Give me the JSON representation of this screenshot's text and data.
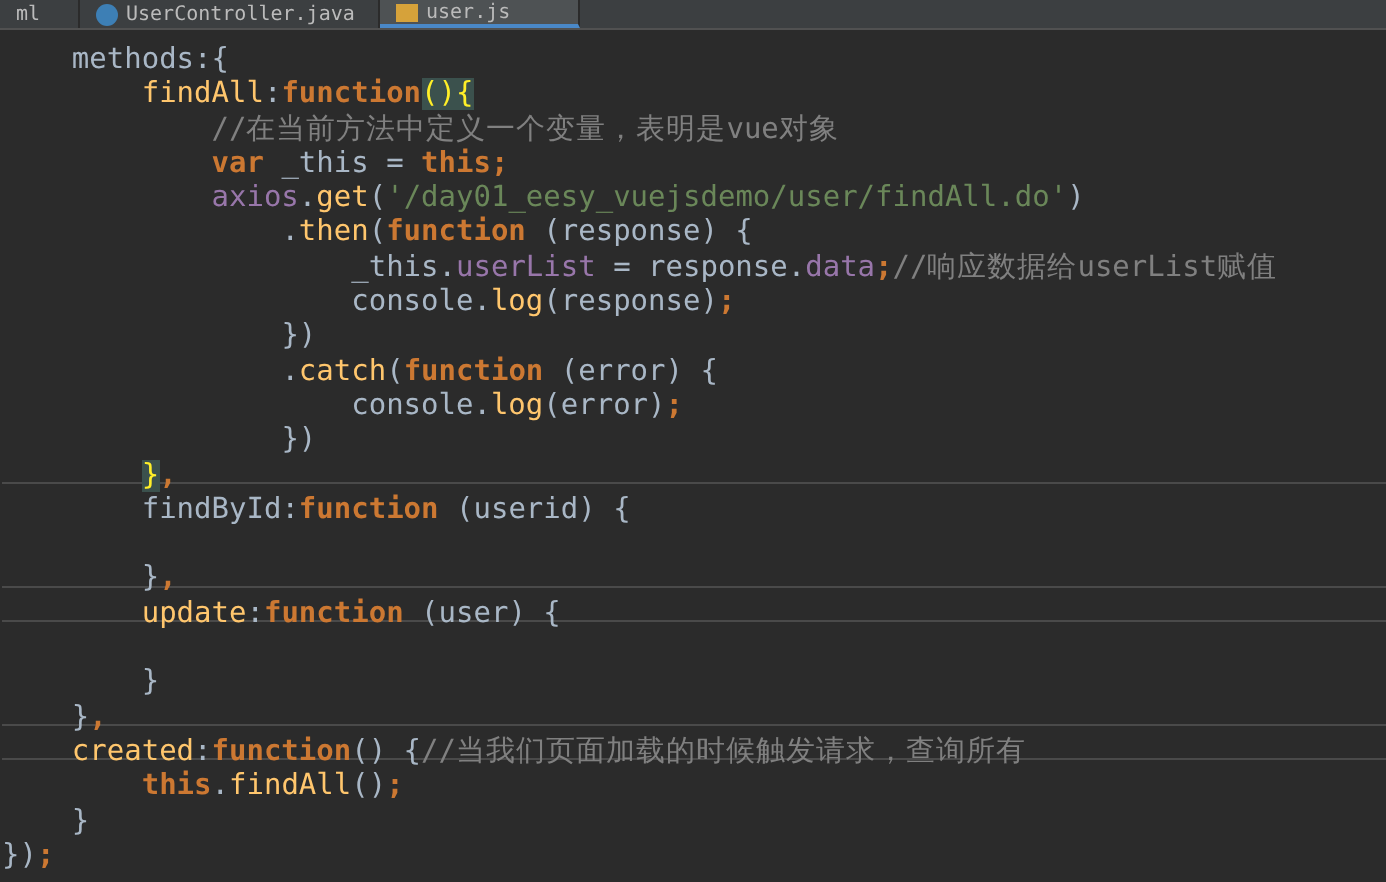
{
  "tabs": [
    {
      "label": "ml",
      "kind": "plain",
      "selected": false
    },
    {
      "label": "UserController.java",
      "kind": "java",
      "selected": false
    },
    {
      "label": "user.js",
      "kind": "js",
      "selected": true
    }
  ],
  "code": [
    {
      "separator_above": false,
      "tokens": [
        {
          "text": "    methods:{",
          "kind": "plain"
        }
      ]
    },
    {
      "separator_above": false,
      "tokens": [
        {
          "text": "        findAll",
          "kind": "member"
        },
        {
          "text": ":",
          "kind": "plain"
        },
        {
          "text": "function",
          "kind": "keyword"
        },
        {
          "text": "(){",
          "kind": "match"
        }
      ]
    },
    {
      "separator_above": false,
      "tokens": [
        {
          "text": "            //在当前方法中定义一个变量，表明是vue对象",
          "kind": "comment"
        }
      ]
    },
    {
      "separator_above": false,
      "tokens": [
        {
          "text": "            var",
          "kind": "keyword"
        },
        {
          "text": " _this = ",
          "kind": "plain"
        },
        {
          "text": "this;",
          "kind": "keyword"
        }
      ]
    },
    {
      "separator_above": false,
      "tokens": [
        {
          "text": "            axios",
          "kind": "field"
        },
        {
          "text": ".",
          "kind": "plain"
        },
        {
          "text": "get",
          "kind": "member"
        },
        {
          "text": "(",
          "kind": "plain"
        },
        {
          "text": "'/day01_eesy_vuejsdemo/user/findAll.do'",
          "kind": "string"
        },
        {
          "text": ")",
          "kind": "plain"
        }
      ]
    },
    {
      "separator_above": false,
      "tokens": [
        {
          "text": "                .",
          "kind": "plain"
        },
        {
          "text": "then",
          "kind": "member"
        },
        {
          "text": "(",
          "kind": "plain"
        },
        {
          "text": "function",
          "kind": "keyword"
        },
        {
          "text": " (response) {",
          "kind": "plain"
        }
      ]
    },
    {
      "separator_above": false,
      "tokens": [
        {
          "text": "                    _this.",
          "kind": "plain"
        },
        {
          "text": "userList",
          "kind": "field"
        },
        {
          "text": " = response.",
          "kind": "plain"
        },
        {
          "text": "data",
          "kind": "field"
        },
        {
          "text": ";",
          "kind": "keyword"
        },
        {
          "text": "//响应数据给userList赋值",
          "kind": "comment"
        }
      ]
    },
    {
      "separator_above": false,
      "tokens": [
        {
          "text": "                    console.",
          "kind": "plain"
        },
        {
          "text": "log",
          "kind": "member"
        },
        {
          "text": "(response)",
          "kind": "plain"
        },
        {
          "text": ";",
          "kind": "keyword"
        }
      ]
    },
    {
      "separator_above": false,
      "tokens": [
        {
          "text": "                })",
          "kind": "plain"
        }
      ]
    },
    {
      "separator_above": false,
      "tokens": [
        {
          "text": "                .",
          "kind": "plain"
        },
        {
          "text": "catch",
          "kind": "member"
        },
        {
          "text": "(",
          "kind": "plain"
        },
        {
          "text": "function",
          "kind": "keyword"
        },
        {
          "text": " (error) {",
          "kind": "plain"
        }
      ]
    },
    {
      "separator_above": false,
      "tokens": [
        {
          "text": "                    console.",
          "kind": "plain"
        },
        {
          "text": "log",
          "kind": "member"
        },
        {
          "text": "(error)",
          "kind": "plain"
        },
        {
          "text": ";",
          "kind": "keyword"
        }
      ]
    },
    {
      "separator_above": false,
      "tokens": [
        {
          "text": "                })",
          "kind": "plain"
        }
      ]
    },
    {
      "separator_above": false,
      "tokens": [
        {
          "text": "        }",
          "kind": "match"
        },
        {
          "text": ",",
          "kind": "keyword"
        }
      ]
    },
    {
      "separator_above": true,
      "tokens": [
        {
          "text": "        findById",
          "kind": "plain"
        },
        {
          "text": ":",
          "kind": "plain"
        },
        {
          "text": "function",
          "kind": "keyword"
        },
        {
          "text": " (userid) {",
          "kind": "plain"
        }
      ]
    },
    {
      "separator_above": false
    },
    {
      "separator_above": false,
      "tokens": [
        {
          "text": "        }",
          "kind": "plain"
        },
        {
          "text": ",",
          "kind": "keyword"
        }
      ]
    },
    {
      "separator_above": true,
      "tokens": [
        {
          "text": "        update",
          "kind": "member"
        },
        {
          "text": ":",
          "kind": "plain"
        },
        {
          "text": "function",
          "kind": "keyword"
        },
        {
          "text": " (user) {",
          "kind": "plain"
        }
      ]
    },
    {
      "separator_above": true
    },
    {
      "separator_above": false,
      "tokens": [
        {
          "text": "        }",
          "kind": "plain"
        }
      ]
    },
    {
      "separator_above": false,
      "tokens": [
        {
          "text": "    }",
          "kind": "plain"
        },
        {
          "text": ",",
          "kind": "keyword"
        }
      ]
    },
    {
      "separator_above": true,
      "tokens": [
        {
          "text": "    created",
          "kind": "member"
        },
        {
          "text": ":",
          "kind": "plain"
        },
        {
          "text": "function",
          "kind": "keyword"
        },
        {
          "text": "() {",
          "kind": "plain"
        },
        {
          "text": "//当我们页面加载的时候触发请求，查询所有",
          "kind": "comment"
        }
      ]
    },
    {
      "separator_above": true,
      "tokens": [
        {
          "text": "        this",
          "kind": "keyword"
        },
        {
          "text": ".",
          "kind": "plain"
        },
        {
          "text": "findAll",
          "kind": "member"
        },
        {
          "text": "()",
          "kind": "plain"
        },
        {
          "text": ";",
          "kind": "keyword"
        }
      ]
    },
    {
      "separator_above": false,
      "tokens": [
        {
          "text": "    }",
          "kind": "plain"
        }
      ]
    },
    {
      "separator_above": false,
      "tokens": [
        {
          "text": "})",
          "kind": "plain"
        },
        {
          "text": ";",
          "kind": "keyword"
        }
      ]
    }
  ]
}
